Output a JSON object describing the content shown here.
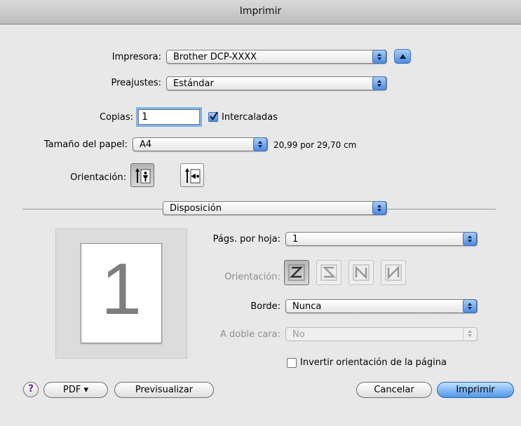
{
  "window": {
    "title": "Imprimir"
  },
  "printer": {
    "label": "Impresora:",
    "value": "Brother DCP-XXXX"
  },
  "presets": {
    "label": "Preajustes:",
    "value": "Estándar"
  },
  "copies": {
    "label": "Copias:",
    "value": "1",
    "collated_label": "Intercaladas",
    "collated_checked": true
  },
  "paper": {
    "label": "Tamaño del papel:",
    "value": "A4",
    "size_text": "20,99 por 29,70 cm"
  },
  "orientation": {
    "label": "Orientación:",
    "options": [
      "portrait-icon",
      "landscape-icon"
    ],
    "selected": "portrait"
  },
  "section": {
    "value": "Disposición"
  },
  "preview": {
    "page_number": "1"
  },
  "layout": {
    "pages_label": "Págs. por hoja:",
    "pages_value": "1",
    "orientation_label": "Orientación:",
    "orientation_options": [
      "z-order-icon",
      "reverse-s-order-icon",
      "n-order-icon",
      "reverse-n-order-icon"
    ],
    "border_label": "Borde:",
    "border_value": "Nunca",
    "duplex_label": "A doble cara:",
    "duplex_value": "No",
    "reverse_label": "Invertir orientación de la página",
    "reverse_checked": false
  },
  "footer": {
    "help_label": "?",
    "pdf_label": "PDF ▾",
    "preview_label": "Previsualizar",
    "cancel_label": "Cancelar",
    "print_label": "Imprimir"
  },
  "colors": {
    "accent": "#4c8ae0",
    "window_bg": "#e8e8e8"
  }
}
